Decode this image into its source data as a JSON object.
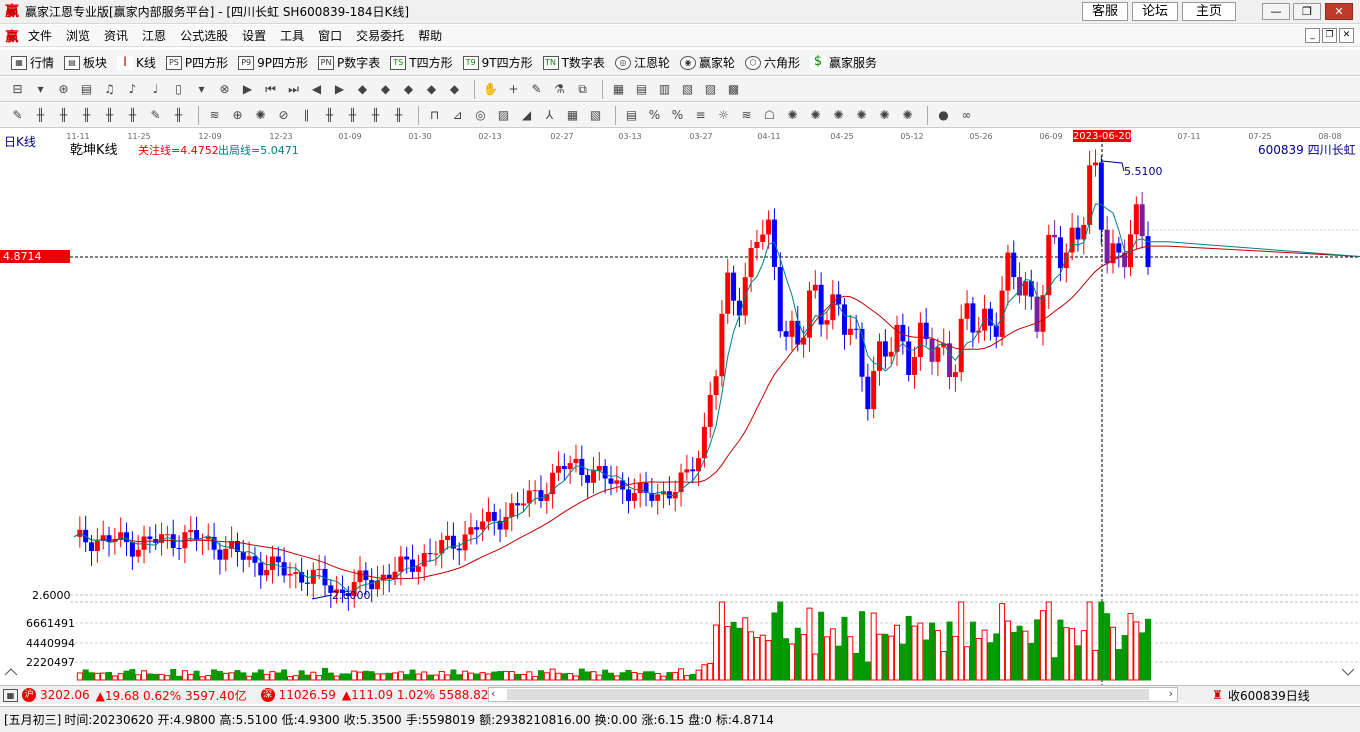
{
  "window": {
    "logo": "赢",
    "title": "赢家江恩专业版[赢家内部服务平台] - [四川长虹  SH600839-184日K线]",
    "nav": [
      "客服",
      "论坛",
      "主页"
    ]
  },
  "menubar": {
    "items": [
      "文件",
      "浏览",
      "资讯",
      "江恩",
      "公式选股",
      "设置",
      "工具",
      "窗口",
      "交易委托",
      "帮助"
    ]
  },
  "toolbar1": {
    "items": [
      {
        "icon": "grid-icon",
        "label": "行情"
      },
      {
        "icon": "blocks-icon",
        "label": "板块"
      },
      {
        "icon": "candle-icon",
        "label": "K线"
      },
      {
        "icon": "ps-icon",
        "label": "P四方形"
      },
      {
        "icon": "p9-icon",
        "label": "9P四方形"
      },
      {
        "icon": "pn-icon",
        "label": "P数字表"
      },
      {
        "icon": "ts-icon",
        "label": "T四方形"
      },
      {
        "icon": "t9-icon",
        "label": "9T四方形"
      },
      {
        "icon": "tn-icon",
        "label": "T数字表"
      },
      {
        "icon": "gann-wheel-icon",
        "label": "江恩轮"
      },
      {
        "icon": "winner-wheel-icon",
        "label": "赢家轮"
      },
      {
        "icon": "hexagon-icon",
        "label": "六角形"
      },
      {
        "icon": "dollar-icon",
        "label": "赢家服务"
      }
    ]
  },
  "chart": {
    "period_label": "日K线",
    "indicator_name": "乾坤K线",
    "focus_line": "关注线=4.4752",
    "exit_line": "出局线=5.0471",
    "stock_info": "600839  四川长虹",
    "cursor_price": "4.8714",
    "high_label": "5.5100",
    "low_label": "2.6000",
    "y_low_tick": "2.6000",
    "x_labels": [
      "11-11",
      "11-25",
      "12-09",
      "12-23",
      "01-09",
      "01-30",
      "02-13",
      "02-27",
      "03-13",
      "03-27",
      "04-11",
      "04-25",
      "05-12",
      "05-26",
      "06-09",
      "2023-06-20",
      "07-11",
      "07-25",
      "08-08"
    ],
    "volume_ticks": [
      "6661491",
      "4440994",
      "2220497"
    ],
    "colors": {
      "up": "#ff0000",
      "down": "#0000ff",
      "purple": "#7b1fa2",
      "ma_short": "#008080",
      "ma_long": "#c00000",
      "vol_up": "#ff0000",
      "vol_down": "#009900"
    }
  },
  "chart_data": {
    "type": "candlestick",
    "title": "",
    "xlabel": "",
    "ylabel": "",
    "ylim": [
      2.6,
      5.51
    ],
    "x_range": [
      "2022-11-11",
      "2023-08-08"
    ],
    "candles_daily_close_approx": [
      2.95,
      2.98,
      2.97,
      2.96,
      2.94,
      2.95,
      2.96,
      2.98,
      2.99,
      2.97,
      2.94,
      2.9,
      2.86,
      2.82,
      2.79,
      2.76,
      2.74,
      2.72,
      2.68,
      2.62,
      2.66,
      2.69,
      2.72,
      2.76,
      2.8,
      2.86,
      2.9,
      2.94,
      3.0,
      3.06,
      3.1,
      3.15,
      3.2,
      3.28,
      3.34,
      3.45,
      3.48,
      3.42,
      3.38,
      3.34,
      3.3,
      3.25,
      3.28,
      3.32,
      3.38,
      3.6,
      4.2,
      4.55,
      4.7,
      5.1,
      4.8,
      4.45,
      4.3,
      4.5,
      4.65,
      4.45,
      4.2,
      4.1,
      4.18,
      4.25,
      4.35,
      4.22,
      4.18,
      4.28,
      4.36,
      4.4,
      4.55,
      4.65,
      4.72,
      4.55,
      4.8,
      4.95,
      5.1,
      5.35,
      5.0,
      4.9,
      4.95,
      5.02
    ],
    "volume_ticks": [
      6661491,
      4440994,
      2220497
    ],
    "annotations": {
      "high": 5.51,
      "low": 2.6,
      "cursor_price": 4.8714
    }
  },
  "status": {
    "sh_index": "3202.06",
    "sh_change": "▲19.68 0.62% 3597.40亿",
    "sz_index": "11026.59",
    "sz_change": "▲111.09 1.02% 5588.82",
    "right_label": "收600839日线"
  },
  "info": {
    "lunar": "[五月初三]",
    "time": "时间:20230620",
    "open": "开:4.9800",
    "high": "高:5.5100",
    "low": "低:4.9300",
    "close": "收:5.3500",
    "volume": "手:5598019",
    "amount": "额:2938210816.00",
    "turnover": "换:0.00",
    "rise": "涨:6.15",
    "flat": "盘:0",
    "mark": "标:4.8714"
  }
}
